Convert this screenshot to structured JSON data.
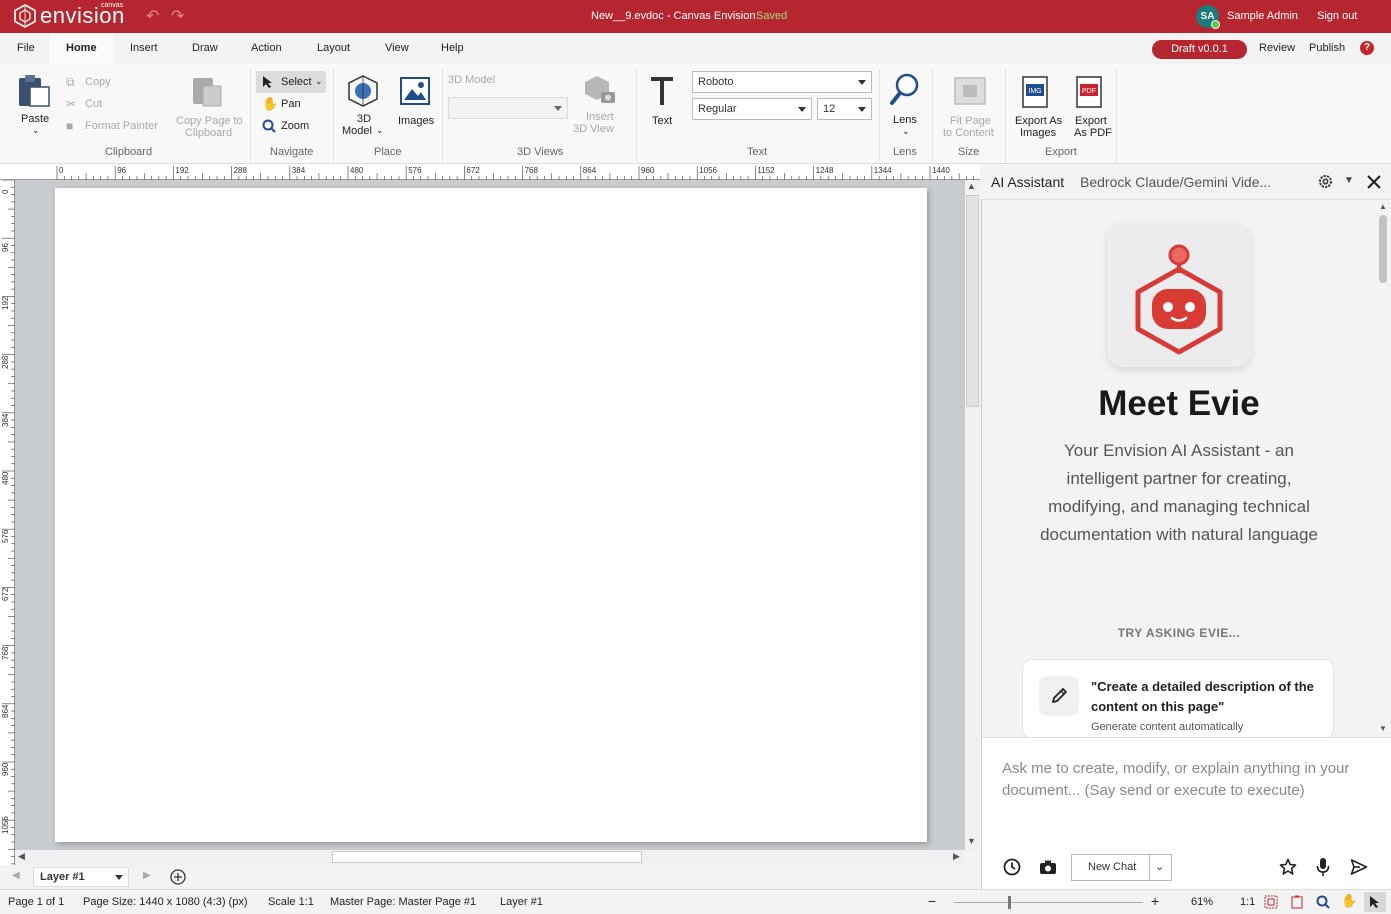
{
  "titlebar": {
    "logo_small": "canvas",
    "logo_word": "envision",
    "title": "New__9.evdoc - Canvas Envision",
    "saved": "Saved",
    "avatar_initials": "SA",
    "user_name": "Sample Admin",
    "sign_out": "Sign out",
    "brand_color": "#b52630"
  },
  "menu": {
    "items": [
      "File",
      "Home",
      "Insert",
      "Draw",
      "Action",
      "Layout",
      "View",
      "Help"
    ],
    "draft": "Draft v0.0.1",
    "review": "Review",
    "publish": "Publish"
  },
  "ribbon": {
    "clipboard": {
      "paste": "Paste",
      "copy": "Copy",
      "cut": "Cut",
      "format_painter": "Format Painter",
      "copy_page_1": "Copy Page to",
      "copy_page_2": "Clipboard",
      "label": "Clipboard"
    },
    "navigate": {
      "select": "Select",
      "pan": "Pan",
      "zoom": "Zoom",
      "label": "Navigate"
    },
    "place": {
      "model_1": "3D",
      "model_2": "Model",
      "images": "Images",
      "label": "Place"
    },
    "views3d": {
      "model_label": "3D Model",
      "insert_1": "Insert",
      "insert_2": "3D View",
      "label": "3D Views"
    },
    "text": {
      "text": "Text",
      "font": "Roboto",
      "style": "Regular",
      "size": "12",
      "label": "Text"
    },
    "lens": {
      "lens": "Lens",
      "label": "Lens"
    },
    "size": {
      "fit_1": "Fit Page",
      "fit_2": "to Content",
      "label": "Size"
    },
    "export": {
      "images_1": "Export As",
      "images_2": "Images",
      "pdf_1": "Export",
      "pdf_2": "As PDF",
      "label": "Export"
    }
  },
  "rulers": {
    "h": [
      "0",
      "96",
      "192",
      "288",
      "384",
      "480",
      "576",
      "672",
      "768",
      "864",
      "960",
      "1056",
      "1152",
      "1248",
      "1344",
      "1440"
    ],
    "v": [
      "0",
      "96",
      "192",
      "288",
      "384",
      "480",
      "576",
      "672",
      "768",
      "864",
      "960",
      "1056"
    ]
  },
  "layer": {
    "current": "Layer #1"
  },
  "status": {
    "page": "Page 1 of 1",
    "page_size": "Page Size: 1440 x 1080 (4:3) (px)",
    "scale": "Scale 1:1",
    "master": "Master Page: Master Page #1",
    "layer": "Layer #1",
    "zoom": "61%",
    "ratio": "1:1"
  },
  "ai": {
    "title": "AI Assistant",
    "model": "Bedrock Claude/Gemini Vide...",
    "heading": "Meet Evie",
    "description": "Your Envision AI Assistant - an intelligent partner for creating, modifying, and managing technical documentation with natural language",
    "try_label": "TRY ASKING EVIE...",
    "suggestion_title": "\"Create a detailed description of the content on this page\"",
    "suggestion_sub": "Generate content automatically",
    "input_placeholder": "Ask me to create, modify, or explain anything in your document... (Say send or execute to execute)",
    "new_chat": "New Chat"
  }
}
